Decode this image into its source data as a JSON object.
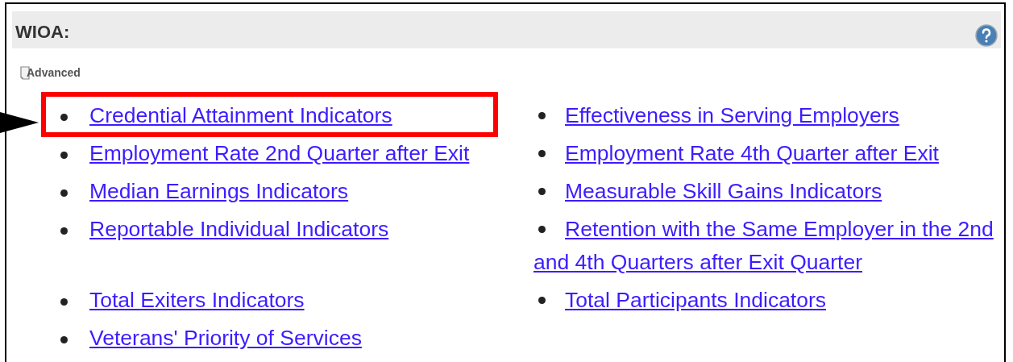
{
  "panel": {
    "title": "WIOA:",
    "advanced_label": "Advanced"
  },
  "left_links": [
    {
      "label": "Credential Attainment Indicators",
      "highlighted": true
    },
    {
      "label": "Employment Rate 2nd Quarter after Exit",
      "highlighted": false
    },
    {
      "label": "Median Earnings Indicators",
      "highlighted": false
    },
    {
      "label": "Reportable Individual Indicators",
      "highlighted": false
    },
    {
      "label": "Total Exiters Indicators",
      "highlighted": false
    },
    {
      "label": "Veterans' Priority of Services",
      "highlighted": false
    }
  ],
  "right_links": [
    {
      "label": "Effectiveness in Serving Employers",
      "highlighted": false
    },
    {
      "label": "Employment Rate 4th Quarter after Exit",
      "highlighted": false
    },
    {
      "label": "Measurable Skill Gains Indicators",
      "highlighted": false
    },
    {
      "label": "Retention with the Same Employer in the 2nd and 4th Quarters after Exit Quarter",
      "highlighted": false
    },
    {
      "label": "Total Participants Indicators",
      "highlighted": false
    }
  ]
}
